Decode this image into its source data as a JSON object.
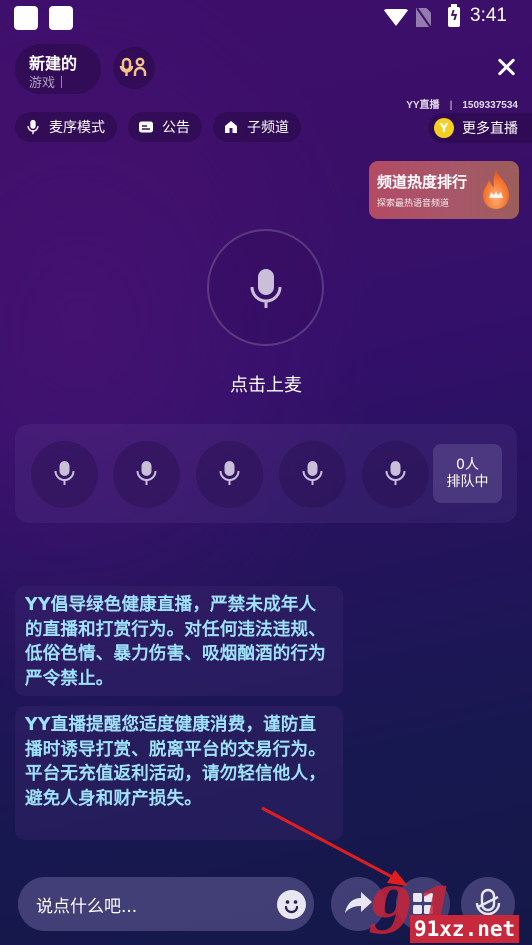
{
  "status_bar": {
    "time": "3:41",
    "icons": [
      "app-square-icon",
      "app-square-icon",
      "wifi-icon",
      "no-sim-icon",
      "battery-charging-icon"
    ]
  },
  "header": {
    "room_name": "新建的",
    "room_category": "游戏",
    "mic_mode_icon": "mic-person-icon",
    "close_icon": "close-icon",
    "channel_brand": "YY直播",
    "channel_id": "1509337534",
    "chips": [
      {
        "label": "麦序模式",
        "icon": "mic-icon"
      },
      {
        "label": "公告",
        "icon": "notice-icon"
      },
      {
        "label": "子频道",
        "icon": "home-icon"
      }
    ],
    "more_live_label": "更多直播",
    "more_live_icon": "yy-logo-icon"
  },
  "rank_card": {
    "title": "频道热度排行",
    "subtitle": "探索最热语音频道",
    "icon": "flame-crown-icon"
  },
  "main_mic": {
    "label": "点击上麦",
    "icon": "mic-icon"
  },
  "seats": {
    "count": 5,
    "icon": "mic-icon",
    "queue_count": "0人",
    "queue_label": "排队中"
  },
  "notices": [
    {
      "text": "YY倡导绿色健康直播，严禁未成年人的直播和打赏行为。对任何违法违规、低俗色情、暴力伤害、吸烟酗酒的行为严令禁止。"
    },
    {
      "text": "YY直播提醒您适度健康消费，谨防直播时诱导打赏、脱离平台的交易行为。平台无充值返利活动，请勿轻信他人，避免人身和财产损失。"
    }
  ],
  "bottom_bar": {
    "input_placeholder": "说点什么吧...",
    "emoji_icon": "smiley-icon",
    "share_icon": "share-icon",
    "more_icon": "grid-icon",
    "mic_toggle_icon": "mic-off-icon"
  },
  "overlay": {
    "watermark_text": "91xz.net",
    "watermark_logo": "91",
    "arrow_color": "#e01e1e"
  }
}
